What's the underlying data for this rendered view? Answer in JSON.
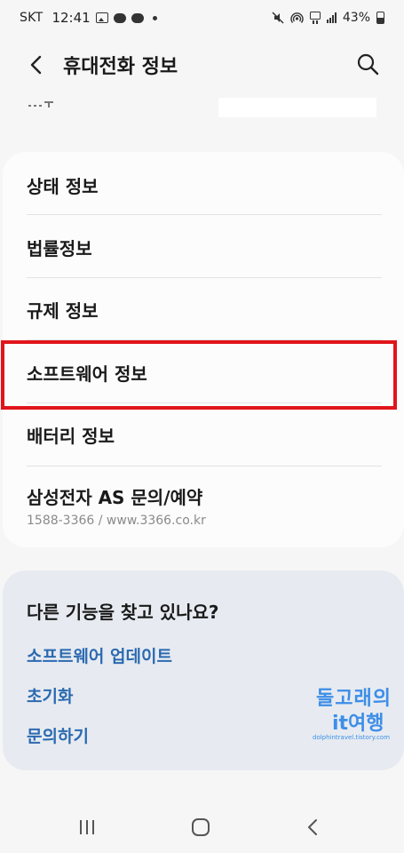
{
  "status_bar": {
    "carrier": "SKT",
    "time": "12:41",
    "battery": "43%",
    "icons": [
      "gallery-icon",
      "chat-icon",
      "talk-icon",
      "dot-icon",
      "mute-icon",
      "hotspot-icon",
      "lte-icon",
      "signal-icon",
      "battery-icon"
    ]
  },
  "app_bar": {
    "title": "휴대전화 정보",
    "back_icon": "back-arrow-icon",
    "search_icon": "search-icon"
  },
  "main_list": {
    "items": [
      {
        "label": "상태 정보"
      },
      {
        "label": "법률정보"
      },
      {
        "label": "규제 정보"
      },
      {
        "label": "소프트웨어 정보"
      },
      {
        "label": "배터리 정보"
      },
      {
        "label": "삼성전자 AS 문의/예약",
        "sub": "1588-3366 / www.3366.co.kr"
      }
    ],
    "highlight_color": "#e0151b"
  },
  "help_card": {
    "title": "다른 기능을 찾고 있나요?",
    "links": [
      "소프트웨어 업데이트",
      "초기화",
      "문의하기"
    ],
    "link_color": "#2c6ab0"
  },
  "watermark": {
    "line1": "돌고래의",
    "line2": "it여행",
    "line3": "dolphintravel.tistory.com"
  },
  "nav_bar": {
    "icons": [
      "recent-apps-icon",
      "home-icon",
      "back-icon"
    ]
  }
}
